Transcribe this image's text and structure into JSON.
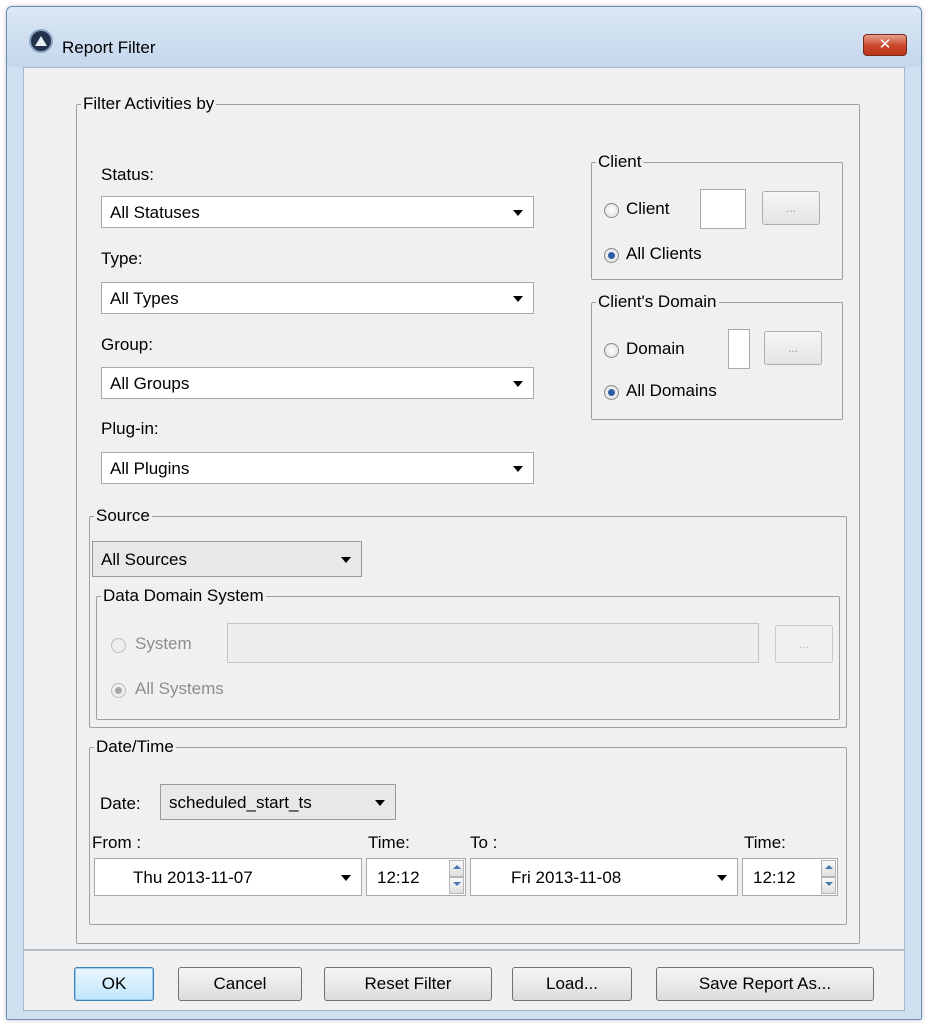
{
  "window": {
    "title": "Report Filter",
    "close_glyph": "✕"
  },
  "filter": {
    "legend": "Filter Activities by",
    "status": {
      "label": "Status:",
      "value": "All Statuses"
    },
    "type": {
      "label": "Type:",
      "value": "All Types"
    },
    "group": {
      "label": "Group:",
      "value": "All Groups"
    },
    "plugin": {
      "label": "Plug-in:",
      "value": "All Plugins"
    }
  },
  "client": {
    "legend": "Client",
    "radio_client": "Client",
    "radio_all": "All Clients",
    "browse": "...",
    "selected": "All Clients"
  },
  "domain": {
    "legend": "Client's Domain",
    "radio_domain": "Domain",
    "radio_all": "All Domains",
    "browse": "...",
    "selected": "All Domains"
  },
  "source": {
    "legend": "Source",
    "value": "All Sources",
    "dds": {
      "legend": "Data Domain System",
      "radio_system": "System",
      "radio_all": "All Systems",
      "browse": "..."
    }
  },
  "datetime": {
    "legend": "Date/Time",
    "date_label": "Date:",
    "date_value": "scheduled_start_ts",
    "from_label": "From :",
    "from_time_label": "Time:",
    "to_label": "To :",
    "to_time_label": "Time:",
    "from_date": "Thu 2013-11-07",
    "from_time": "12:12",
    "to_date": "Fri 2013-11-08",
    "to_time": "12:12"
  },
  "buttons": {
    "ok": "OK",
    "cancel": "Cancel",
    "reset": "Reset Filter",
    "load": "Load...",
    "save_as": "Save Report As..."
  },
  "colors": {
    "window_frame": "#cfdff0",
    "dialog_bg": "#f0f0f0",
    "close_button": "#c8452a",
    "radio_dot": "#2a5ca8"
  }
}
